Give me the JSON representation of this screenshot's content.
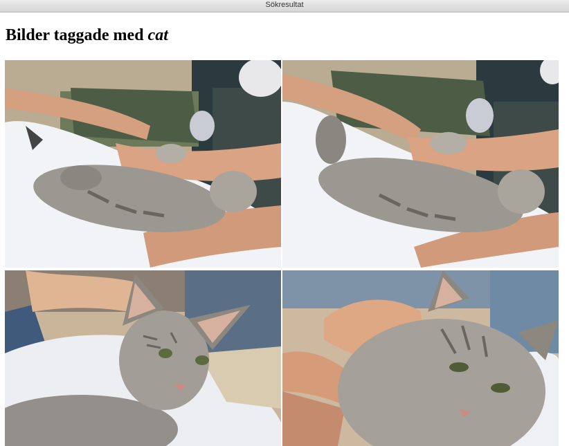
{
  "window": {
    "title": "Sökresultat"
  },
  "heading": {
    "prefix": "Bilder taggade med",
    "tag": "cat"
  },
  "gallery": {
    "images": [
      {
        "name": "cat-photo-1"
      },
      {
        "name": "cat-photo-2"
      },
      {
        "name": "cat-photo-3"
      },
      {
        "name": "cat-photo-4"
      }
    ]
  }
}
